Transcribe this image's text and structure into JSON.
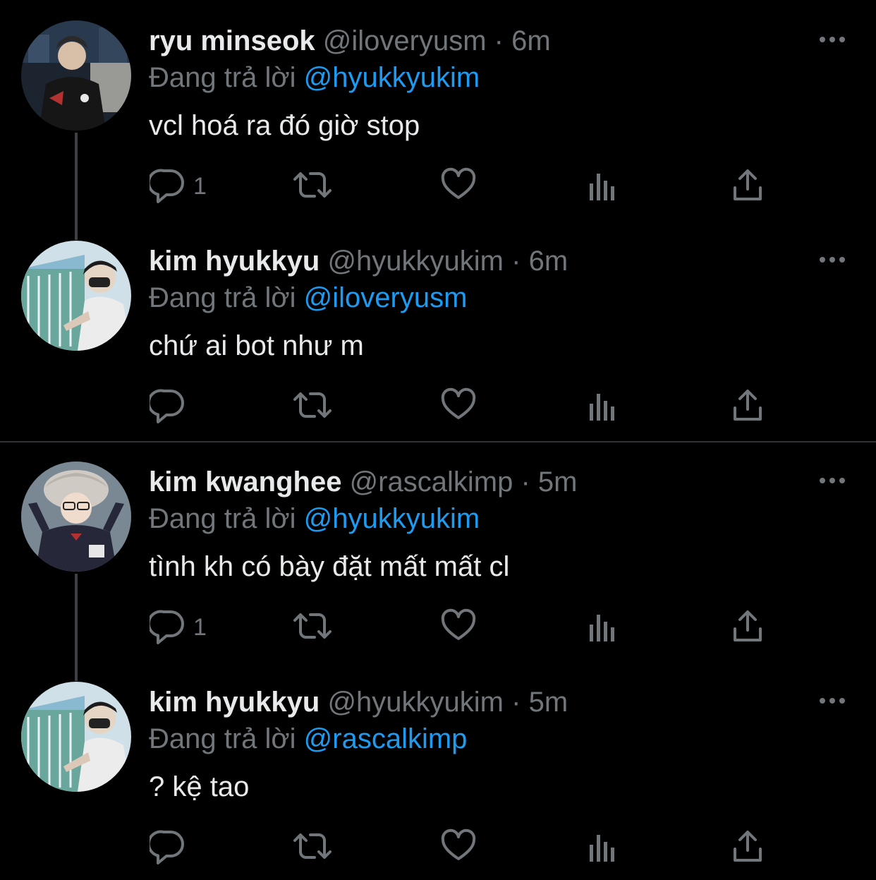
{
  "tweets": [
    {
      "name": "ryu minseok",
      "handle": "@iloveryusm",
      "dot": "·",
      "time": "6m",
      "reply_prefix": "Đang trả lời",
      "reply_to": "@hyukkyukim",
      "text": "vcl hoá ra đó giờ stop",
      "reply_count": "1"
    },
    {
      "name": "kim hyukkyu",
      "handle": "@hyukkyukim",
      "dot": "·",
      "time": "6m",
      "reply_prefix": "Đang trả lời",
      "reply_to": "@iloveryusm",
      "text": "chứ ai bot như m",
      "reply_count": ""
    },
    {
      "name": "kim kwanghee",
      "handle": "@rascalkimp",
      "dot": "·",
      "time": "5m",
      "reply_prefix": "Đang trả lời",
      "reply_to": "@hyukkyukim",
      "text": "tình kh có bày đặt mất mất cl",
      "reply_count": "1"
    },
    {
      "name": "kim hyukkyu",
      "handle": "@hyukkyukim",
      "dot": "·",
      "time": "5m",
      "reply_prefix": "Đang trả lời",
      "reply_to": "@rascalkimp",
      "text": "? kệ tao",
      "reply_count": ""
    }
  ],
  "colors": {
    "background": "#000000",
    "text_primary": "#e7e9ea",
    "text_secondary": "#71767b",
    "accent": "#1d9bf0",
    "thread_line": "#3e4144",
    "separator": "#2f3336"
  },
  "icons": [
    "more-icon",
    "reply-icon",
    "retweet-icon",
    "like-icon",
    "views-icon",
    "share-icon"
  ]
}
